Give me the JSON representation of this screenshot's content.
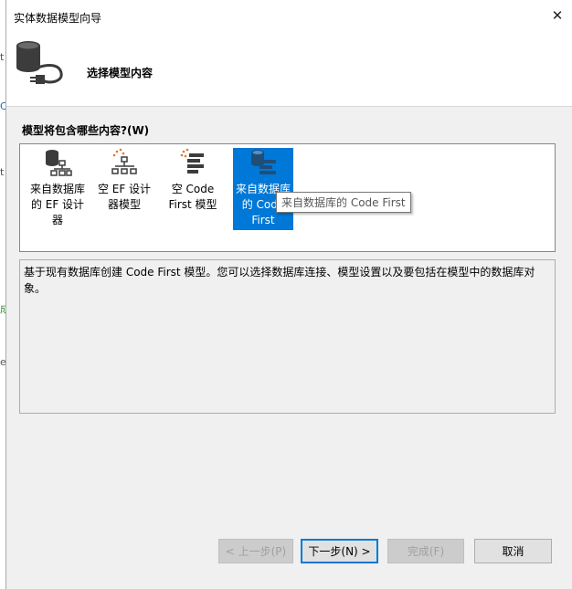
{
  "window": {
    "title": "实体数据模型向导",
    "close_label": "✕"
  },
  "header": {
    "title": "选择模型内容"
  },
  "content": {
    "label": "模型将包含哪些内容?(W)"
  },
  "options": [
    {
      "label": "来自数据库的 EF 设计器",
      "icon": "database-designer-icon"
    },
    {
      "label": "空 EF 设计器模型",
      "icon": "empty-designer-icon"
    },
    {
      "label": "空 Code First 模型",
      "icon": "empty-code-first-icon"
    },
    {
      "label": "来自数据库的 Code First",
      "icon": "database-code-first-icon",
      "selected": true
    }
  ],
  "tooltip": "来自数据库的 Code First",
  "description": "基于现有数据库创建 Code First 模型。您可以选择数据库连接、模型设置以及要包括在模型中的数据库对象。",
  "buttons": {
    "back": "< 上一步(P)",
    "next": "下一步(N) >",
    "finish": "完成(F)",
    "cancel": "取消"
  },
  "colors": {
    "selection": "#0078d7",
    "accent_orange": "#e8732a",
    "dark_icon": "#3c3c3c"
  }
}
